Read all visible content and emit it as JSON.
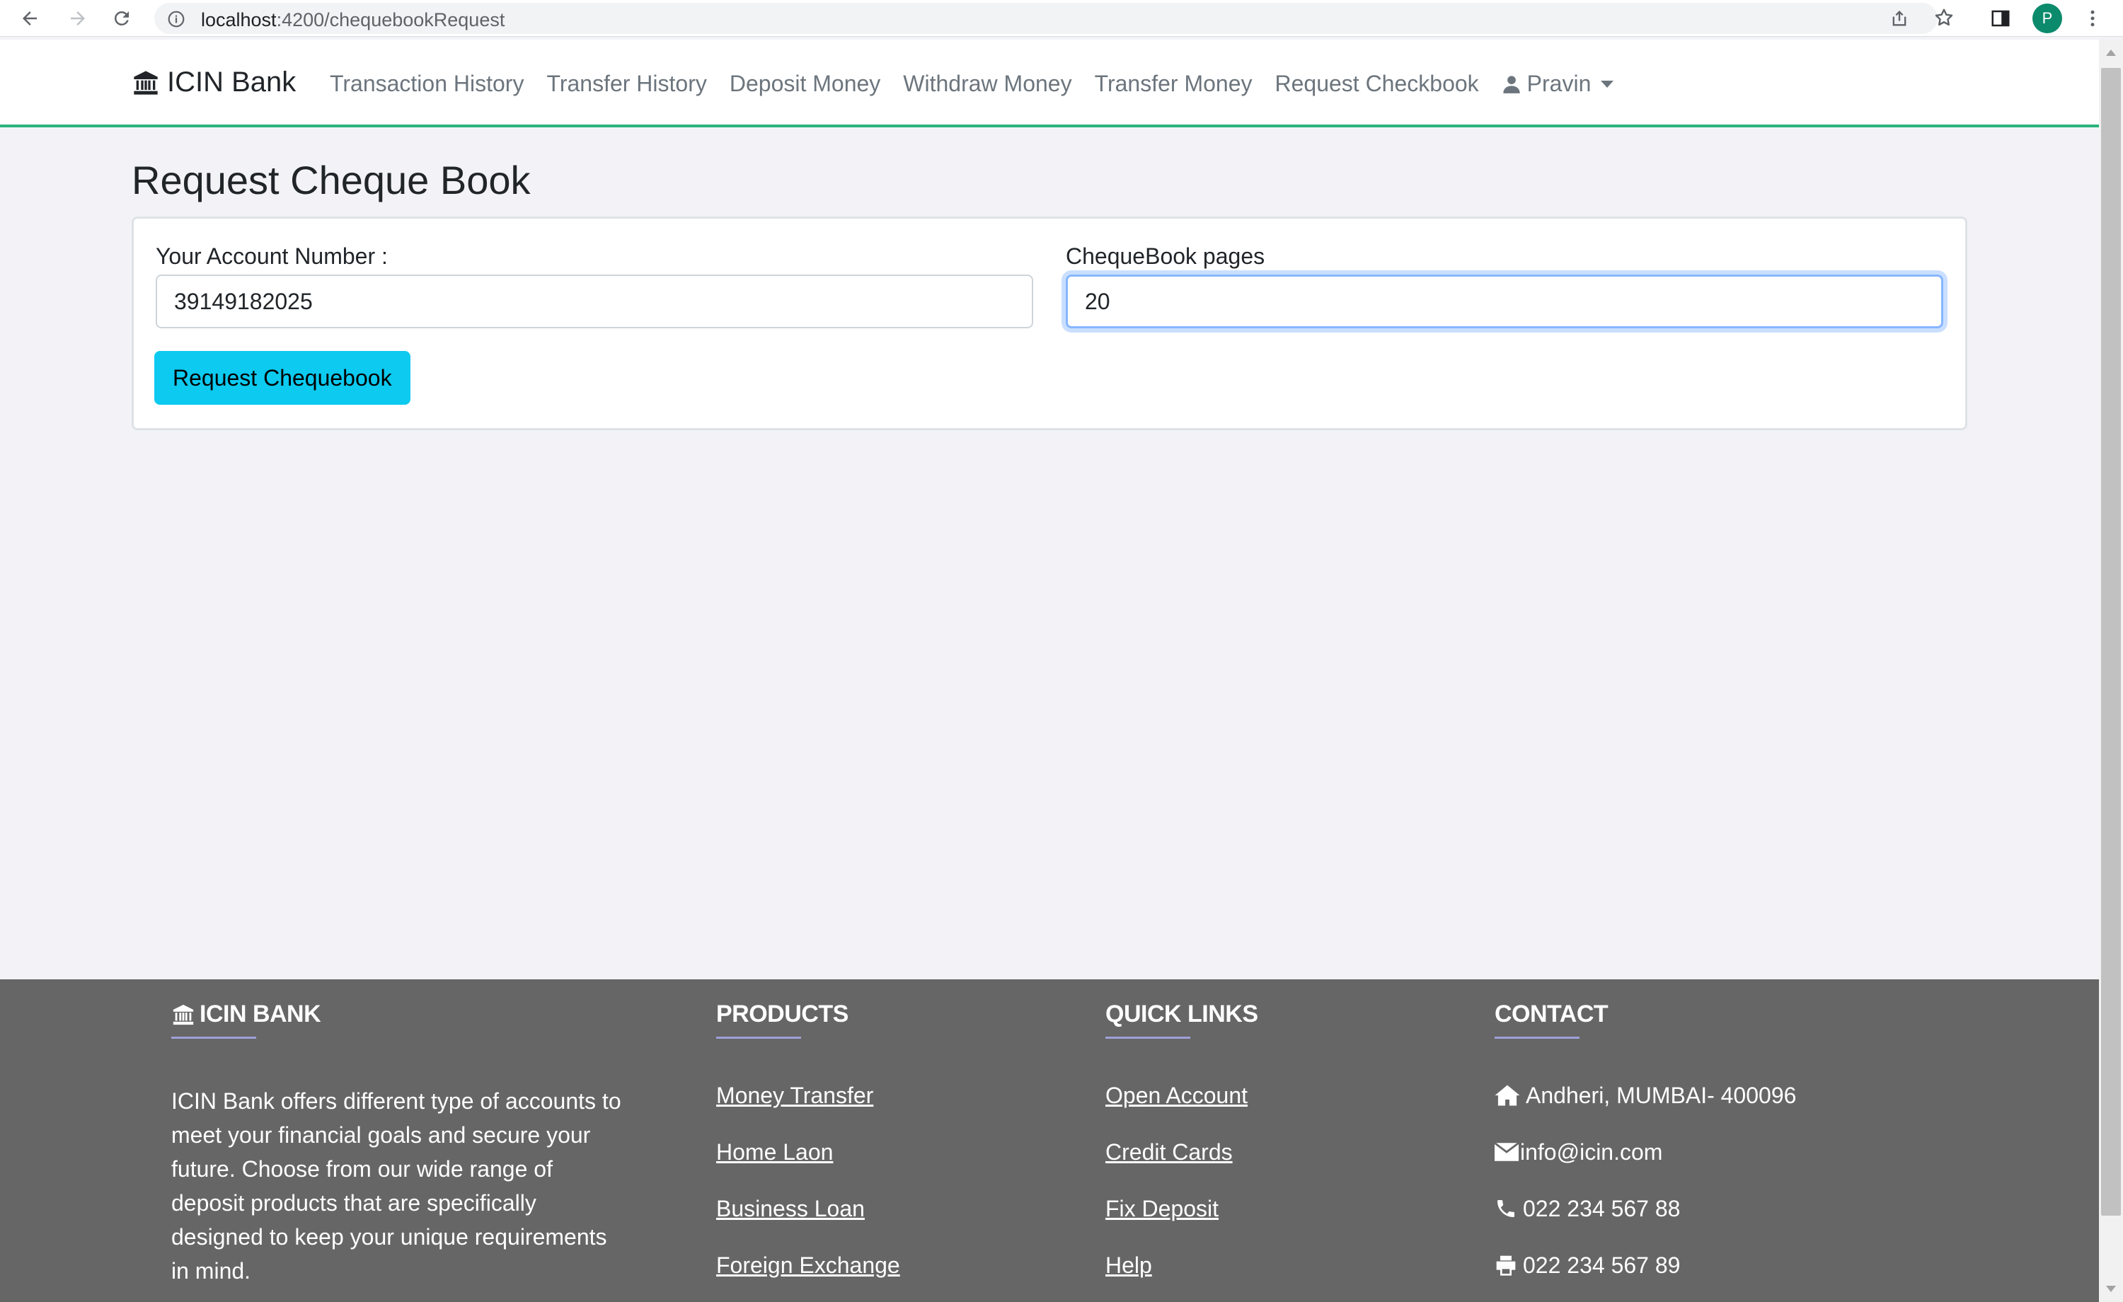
{
  "browser": {
    "url_host": "localhost",
    "url_path": ":4200/chequebookRequest",
    "profile_initial": "P"
  },
  "navbar": {
    "brand": "ICIN Bank",
    "links": [
      {
        "label": "Transaction History"
      },
      {
        "label": "Transfer History"
      },
      {
        "label": "Deposit Money"
      },
      {
        "label": "Withdraw Money"
      },
      {
        "label": "Transfer Money"
      },
      {
        "label": "Request Checkbook"
      }
    ],
    "user": "Pravin"
  },
  "main": {
    "title": "Request Cheque Book",
    "account_label": "Your Account Number :",
    "account_value": "39149182025",
    "pages_label": "ChequeBook pages",
    "pages_value": "20",
    "submit_label": "Request Chequebook"
  },
  "footer": {
    "about": {
      "heading": "ICIN BANK",
      "text": "ICIN Bank offers different type of accounts to meet your financial goals and secure your future. Choose from our wide range of deposit products that are specifically designed to keep your unique requirements in mind."
    },
    "products": {
      "heading": "PRODUCTS",
      "links": [
        "Money Transfer",
        "Home Laon",
        "Business Loan",
        "Foreign Exchange"
      ]
    },
    "quick_links": {
      "heading": "QUICK LINKS",
      "links": [
        "Open Account",
        "Credit Cards",
        "Fix Deposit",
        "Help"
      ]
    },
    "contact": {
      "heading": "CONTACT",
      "address": "Andheri, MUMBAI- 400096",
      "email": "info@icin.com",
      "phone": "022 234 567 88",
      "fax": "022 234 567 89"
    }
  },
  "colors": {
    "navbar_border": "#2ab37d",
    "button": "#0dcaf0",
    "footer_bg": "#666666",
    "profile": "#0b8a6c"
  }
}
